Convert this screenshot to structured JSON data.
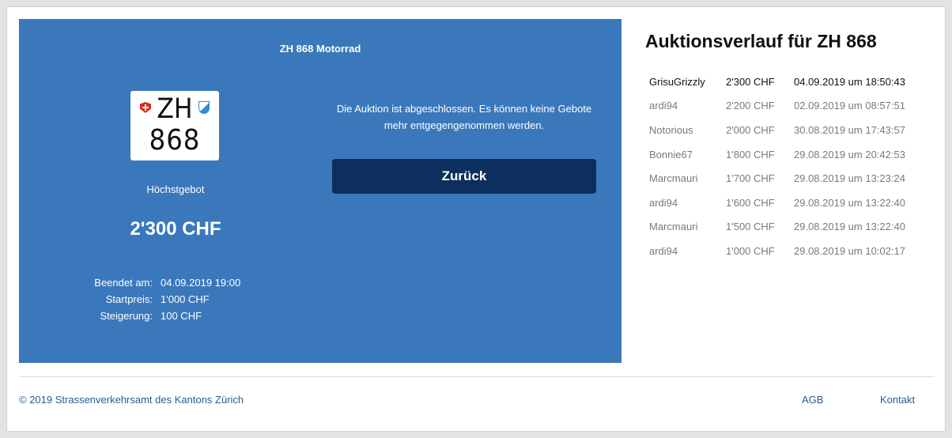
{
  "auction": {
    "title": "ZH 868 Motorrad",
    "plate": {
      "canton": "ZH",
      "number": "868"
    },
    "highest_bid_label": "Höchstgebot",
    "highest_bid_amount": "2'300 CHF",
    "details": [
      {
        "label": "Beendet am:",
        "value": "04.09.2019 19:00"
      },
      {
        "label": "Startpreis:",
        "value": "1'000 CHF"
      },
      {
        "label": "Steigerung:",
        "value": "100 CHF"
      }
    ],
    "closed_message": "Die Auktion ist abgeschlossen. Es können keine Gebote mehr entgegengenommen werden.",
    "back_label": "Zurück"
  },
  "history": {
    "title": "Auktionsverlauf für ZH 868",
    "rows": [
      {
        "user": "GrisuGrizzly",
        "amount": "2'300 CHF",
        "time": "04.09.2019 um 18:50:43"
      },
      {
        "user": "ardi94",
        "amount": "2'200 CHF",
        "time": "02.09.2019 um 08:57:51"
      },
      {
        "user": "Notorious",
        "amount": "2'000 CHF",
        "time": "30.08.2019 um 17:43:57"
      },
      {
        "user": "Bonnie67",
        "amount": "1'800 CHF",
        "time": "29.08.2019 um 20:42:53"
      },
      {
        "user": "Marcmauri",
        "amount": "1'700 CHF",
        "time": "29.08.2019 um 13:23:24"
      },
      {
        "user": "ardi94",
        "amount": "1'600 CHF",
        "time": "29.08.2019 um 13:22:40"
      },
      {
        "user": "Marcmauri",
        "amount": "1'500 CHF",
        "time": "29.08.2019 um 13:22:40"
      },
      {
        "user": "ardi94",
        "amount": "1'000 CHF",
        "time": "29.08.2019 um 10:02:17"
      }
    ]
  },
  "footer": {
    "copyright": "© 2019 Strassenverkehrsamt des Kantons Zürich",
    "links": {
      "agb": "AGB",
      "contact": "Kontakt"
    }
  },
  "colors": {
    "panel": "#3b78bb",
    "button": "#0d2f5e",
    "link": "#2a5b8f"
  },
  "icons": {
    "flag": "swiss-flag-icon",
    "crest": "zurich-crest-icon"
  }
}
